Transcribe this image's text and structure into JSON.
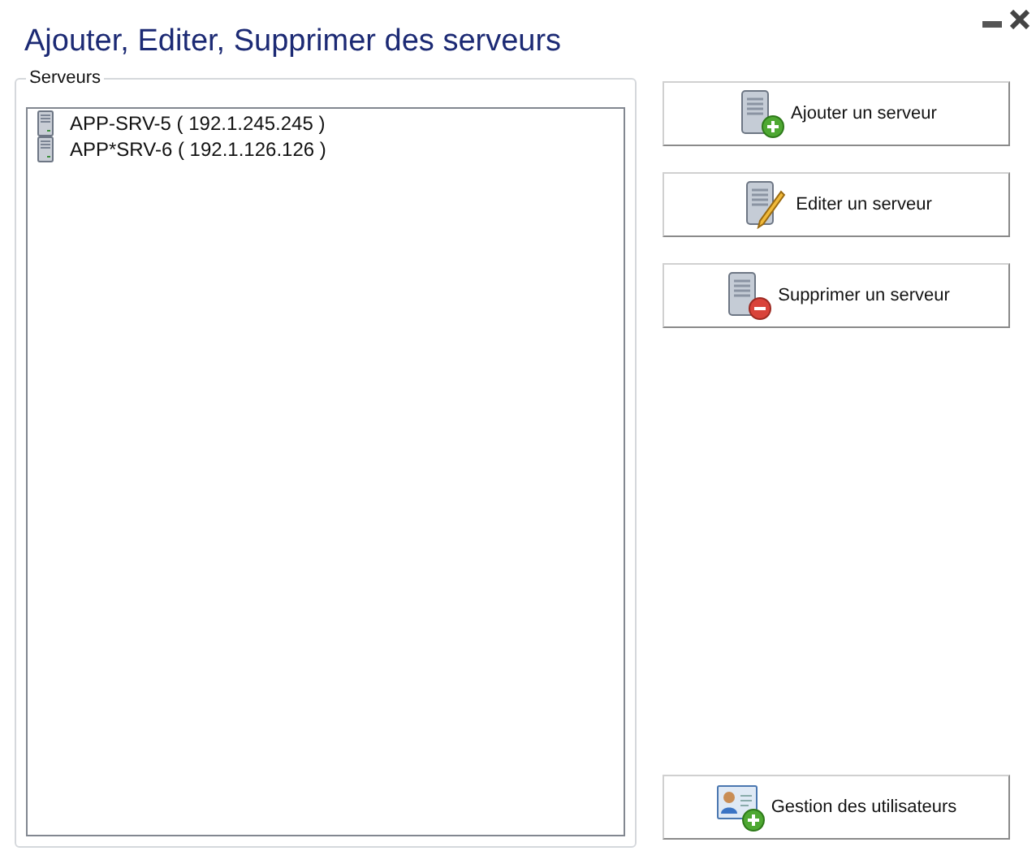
{
  "window": {
    "title": "Ajouter, Editer, Supprimer des serveurs"
  },
  "servers_group": {
    "label": "Serveurs",
    "items": [
      {
        "label": "APP-SRV-5 ( 192.1.245.245 )"
      },
      {
        "label": "APP*SRV-6 ( 192.1.126.126 )"
      }
    ]
  },
  "buttons": [
    {
      "label": "Ajouter un serveur",
      "kind": "add"
    },
    {
      "label": "Editer un serveur",
      "kind": "edit"
    },
    {
      "label": "Supprimer un serveur",
      "kind": "delete"
    }
  ],
  "bottom_button": {
    "label": "Gestion des utilisateurs",
    "kind": "users"
  }
}
